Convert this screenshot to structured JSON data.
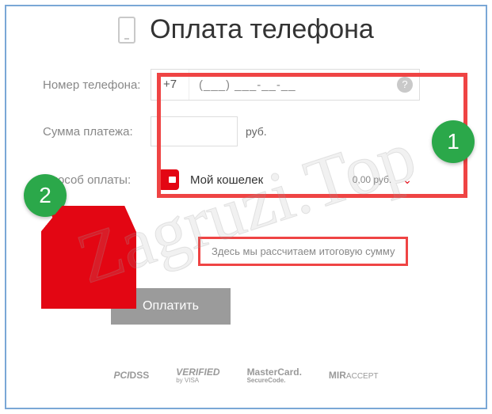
{
  "title": "Оплата телефона",
  "labels": {
    "phone": "Номер телефона:",
    "amount": "Сумма платежа:",
    "method": "Способ оплаты:"
  },
  "phone": {
    "prefix": "+7",
    "mask": "(___) ___-__-__",
    "help": "?"
  },
  "amount": {
    "currency": "руб."
  },
  "wallet": {
    "name": "Мой кошелек",
    "balance": "0,00 руб."
  },
  "summary": {
    "placeholder": "Здесь мы рассчитаем итоговую сумму"
  },
  "actions": {
    "pay": "Оплатить"
  },
  "logos": {
    "pci": "PCI",
    "pci_sub": "DSS",
    "visa_top": "VERIFIED",
    "visa_sub": "by VISA",
    "mc_top": "MasterCard.",
    "mc_sub": "SecureCode.",
    "mir": "MIR",
    "mir_sub": "ACCEPT"
  },
  "annotations": {
    "badge1": "1",
    "badge2": "2"
  },
  "watermark": "Zagruzi.Top"
}
